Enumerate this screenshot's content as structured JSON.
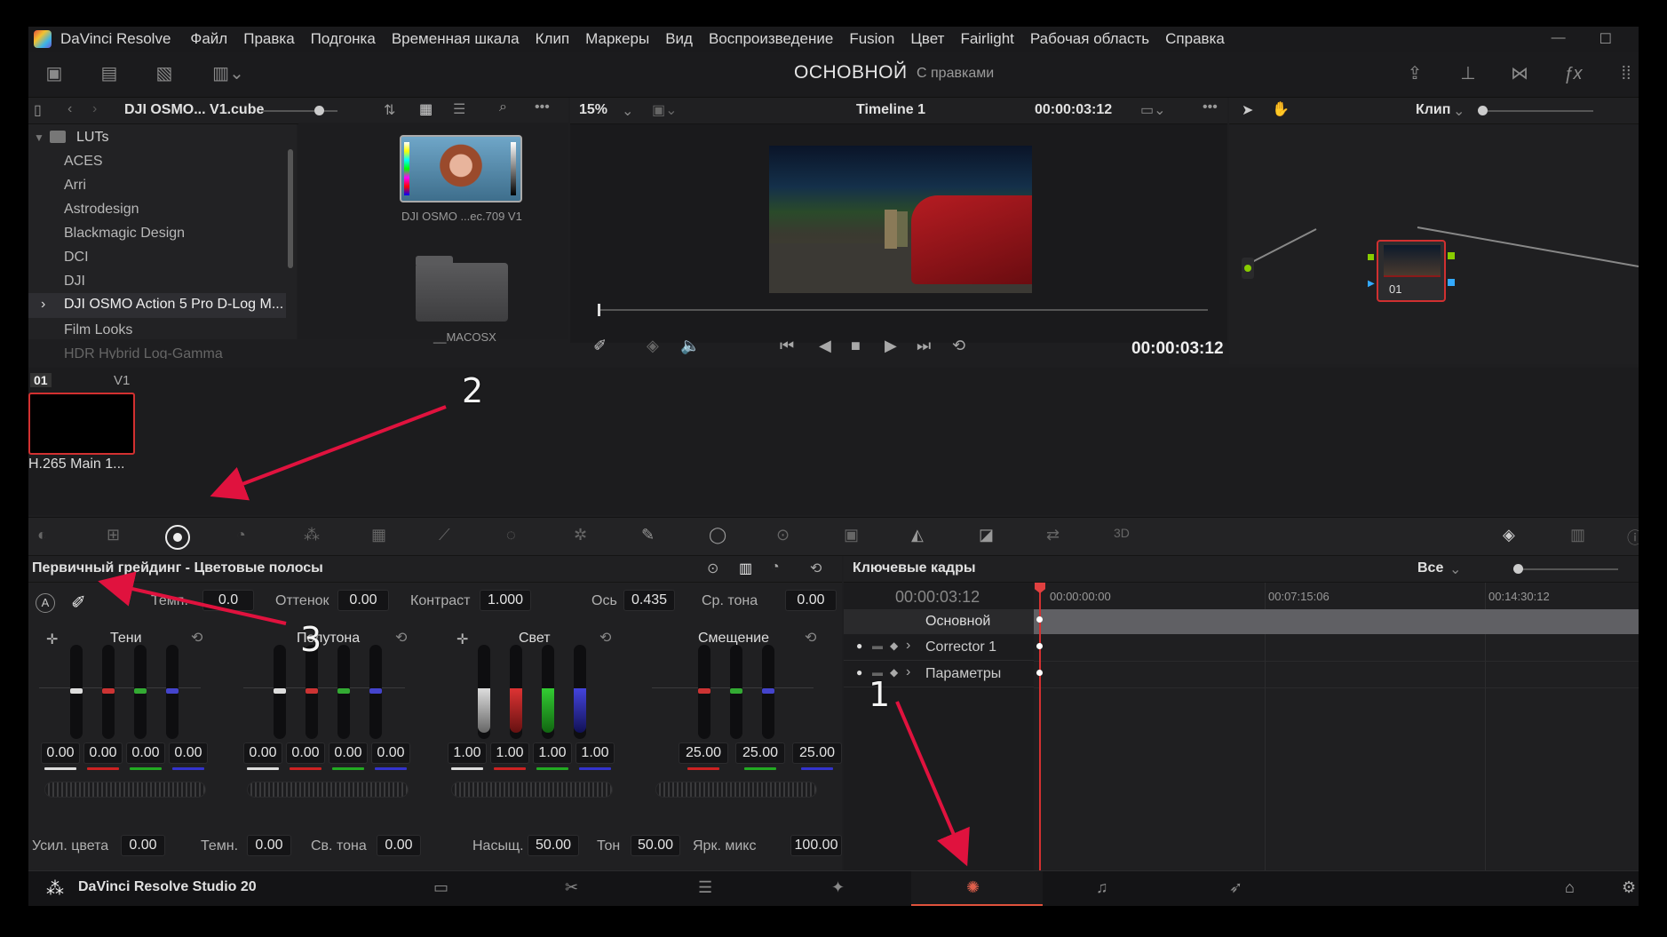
{
  "app": {
    "name": "DaVinci Resolve",
    "product": "DaVinci Resolve Studio 20"
  },
  "menu": [
    "Файл",
    "Правка",
    "Подгонка",
    "Временная шкала",
    "Клип",
    "Маркеры",
    "Вид",
    "Воспроизведение",
    "Fusion",
    "Цвет",
    "Fairlight",
    "Рабочая область",
    "Справка"
  ],
  "header": {
    "title": "ОСНОВНОЙ",
    "subtitle": "С правками"
  },
  "browser": {
    "path": "DJI OSMO... V1.cube",
    "items": [
      "LUTs",
      "ACES",
      "Arri",
      "Astrodesign",
      "Blackmagic Design",
      "DCI",
      "DJI",
      "DJI OSMO Action 5 Pro D-Log M...",
      "Film Looks",
      "HDR Hybrid Log-Gamma"
    ],
    "thumb1": "DJI OSMO ...ec.709 V1",
    "thumb2": "__MACOSX"
  },
  "viewer": {
    "zoom": "15%",
    "timeline": "Timeline 1",
    "timecode_top": "00:00:03:12",
    "timecode": "00:00:03:12"
  },
  "nodes": {
    "mode": "Клип",
    "node_label": "01"
  },
  "clips": {
    "index": "01",
    "track": "V1",
    "clip_name": "H.265 Main 1..."
  },
  "primary": {
    "title": "Первичный грейдинг - Цветовые полосы",
    "top": {
      "temp_label": "Темп.",
      "temp": "0.0",
      "tint_label": "Оттенок",
      "tint": "0.00",
      "contrast_label": "Контраст",
      "contrast": "1.000",
      "pivot_label": "Ось",
      "pivot": "0.435",
      "midtone_label": "Ср. тона",
      "midtone": "0.00"
    },
    "groups": [
      {
        "name": "Тени",
        "vals": [
          "0.00",
          "0.00",
          "0.00",
          "0.00"
        ]
      },
      {
        "name": "Полутона",
        "vals": [
          "0.00",
          "0.00",
          "0.00",
          "0.00"
        ]
      },
      {
        "name": "Свет",
        "vals": [
          "1.00",
          "1.00",
          "1.00",
          "1.00"
        ]
      },
      {
        "name": "Смещение",
        "vals": [
          "25.00",
          "25.00",
          "25.00"
        ]
      }
    ],
    "bottom": {
      "boost_label": "Усил. цвета",
      "boost": "0.00",
      "shadow_label": "Темн.",
      "shadow": "0.00",
      "hl_label": "Св. тона",
      "hl": "0.00",
      "sat_label": "Насыщ.",
      "sat": "50.00",
      "hue_label": "Тон",
      "hue": "50.00",
      "lummix_label": "Ярк. микс",
      "lummix": "100.00"
    }
  },
  "keyframes": {
    "title": "Ключевые кадры",
    "filter": "Все",
    "timecode": "00:00:03:12",
    "ruler": [
      "00:00:00:00",
      "00:07:15:06",
      "00:14:30:12"
    ],
    "tracks": [
      "Основной",
      "Corrector 1",
      "Параметры"
    ]
  },
  "annotations": [
    "1",
    "2",
    "3"
  ],
  "colors": {
    "accent": "#e0123e",
    "active_page": "#e0523c"
  }
}
